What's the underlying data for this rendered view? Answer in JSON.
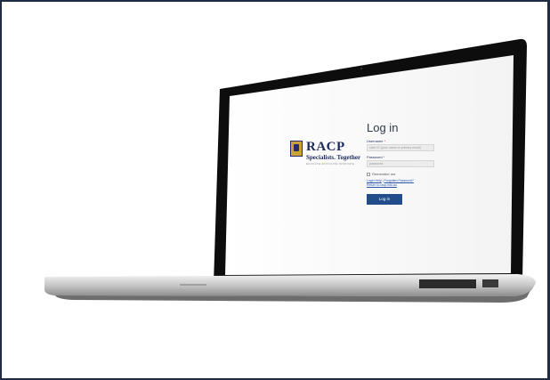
{
  "brand": {
    "name": "RACP",
    "tagline": "Specialists. Together",
    "subline": "EDUCATE  ADVOCATE  INNOVATE"
  },
  "login": {
    "title": "Log in",
    "username_label": "Username",
    "username_placeholder": "User ID (your name or primary email)",
    "password_label": "Password",
    "password_placeholder": "password",
    "required_mark": "*",
    "remember_label": "Remember me",
    "links": {
      "help": "Login Help",
      "separator": " | ",
      "forgot": "Forgotten Password?",
      "return": "Return to racp.edu.au"
    },
    "submit_label": "Log in"
  },
  "colors": {
    "border": "#1f2d44",
    "brand_navy": "#1d2b5a",
    "button": "#214e8a",
    "link": "#2453a8"
  }
}
